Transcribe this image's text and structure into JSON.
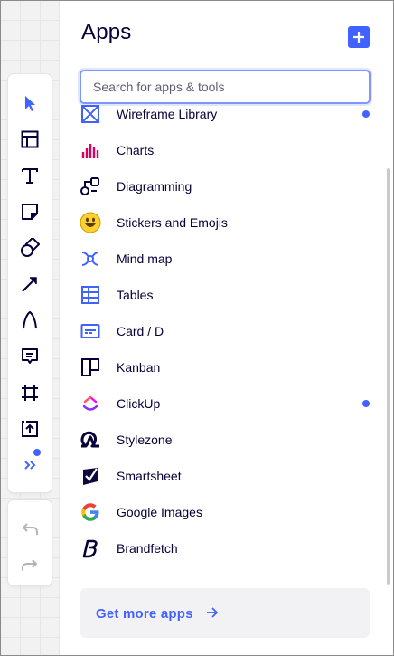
{
  "toolbar": {
    "tools": [
      {
        "name": "select-tool",
        "icon": "cursor-icon"
      },
      {
        "name": "templates-tool",
        "icon": "layout-icon"
      },
      {
        "name": "text-tool",
        "icon": "text-icon"
      },
      {
        "name": "sticky-note-tool",
        "icon": "sticky-note-icon"
      },
      {
        "name": "shapes-tool",
        "icon": "shapes-icon"
      },
      {
        "name": "connection-line-tool",
        "icon": "arrow-icon"
      },
      {
        "name": "pen-tool",
        "icon": "pen-icon"
      },
      {
        "name": "comment-tool",
        "icon": "comment-icon"
      },
      {
        "name": "frame-tool",
        "icon": "frame-icon"
      },
      {
        "name": "upload-tool",
        "icon": "upload-icon"
      },
      {
        "name": "more-tools-button",
        "icon": "double-chevron-icon"
      }
    ],
    "history": [
      {
        "name": "undo-button",
        "icon": "undo-icon"
      },
      {
        "name": "redo-button",
        "icon": "redo-icon"
      }
    ]
  },
  "panel": {
    "title": "Apps",
    "search_placeholder": "Search for apps & tools",
    "apps": [
      {
        "label": "Wireframe Library",
        "icon": "wireframe-icon",
        "new": true
      },
      {
        "label": "Charts",
        "icon": "charts-icon",
        "new": false
      },
      {
        "label": "Diagramming",
        "icon": "diagramming-icon",
        "new": false
      },
      {
        "label": "Stickers and Emojis",
        "icon": "emoji-icon",
        "new": false
      },
      {
        "label": "Mind map",
        "icon": "mind-map-icon",
        "new": false
      },
      {
        "label": "Tables",
        "icon": "table-icon",
        "new": false
      },
      {
        "label": "Card / D",
        "icon": "card-icon",
        "new": false
      },
      {
        "label": "Kanban",
        "icon": "kanban-icon",
        "new": false
      },
      {
        "label": "ClickUp",
        "icon": "clickup-icon",
        "new": true
      },
      {
        "label": "Stylezone",
        "icon": "stylezone-icon",
        "new": false
      },
      {
        "label": "Smartsheet",
        "icon": "smartsheet-icon",
        "new": false
      },
      {
        "label": "Google Images",
        "icon": "google-icon",
        "new": false
      },
      {
        "label": "Brandfetch",
        "icon": "brandfetch-icon",
        "new": false
      }
    ],
    "more_apps_label": "Get more apps"
  },
  "colors": {
    "accent": "#4262ff",
    "text": "#050038",
    "charts": "#da0063"
  }
}
